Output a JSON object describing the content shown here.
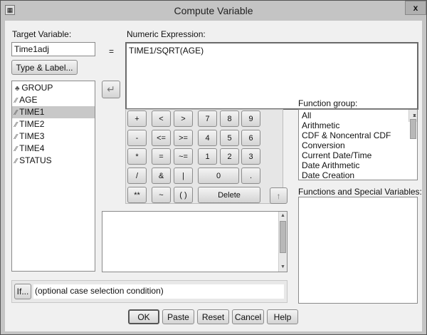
{
  "window": {
    "title": "Compute Variable",
    "close_label": "x"
  },
  "target": {
    "label": "Target Variable:",
    "value": "Time1adj",
    "type_label_button": "Type & Label..."
  },
  "equals": "=",
  "expression": {
    "label": "Numeric Expression:",
    "value": "TIME1/SQRT(AGE)"
  },
  "variables": [
    {
      "name": "GROUP",
      "icon": "nominal-icon",
      "selected": false
    },
    {
      "name": "AGE",
      "icon": "scale-ruler-icon",
      "selected": false
    },
    {
      "name": "TIME1",
      "icon": "scale-ruler-icon",
      "selected": true
    },
    {
      "name": "TIME2",
      "icon": "scale-ruler-icon",
      "selected": false
    },
    {
      "name": "TIME3",
      "icon": "scale-ruler-icon",
      "selected": false
    },
    {
      "name": "TIME4",
      "icon": "scale-ruler-icon",
      "selected": false
    },
    {
      "name": "STATUS",
      "icon": "scale-ruler-icon",
      "selected": false
    }
  ],
  "keypad": {
    "plus": "+",
    "lt": "<",
    "gt": ">",
    "k7": "7",
    "k8": "8",
    "k9": "9",
    "minus": "-",
    "le": "<=",
    "ge": ">=",
    "k4": "4",
    "k5": "5",
    "k6": "6",
    "mul": "*",
    "eq": "=",
    "ne": "~=",
    "k1": "1",
    "k2": "2",
    "k3": "3",
    "div": "/",
    "and": "&",
    "or": "|",
    "k0": "0",
    "dot": ".",
    "pow": "**",
    "not": "~",
    "paren": "( )",
    "delete": "Delete"
  },
  "function_group": {
    "label": "Function group:",
    "items": [
      "All",
      "Arithmetic",
      "CDF & Noncentral CDF",
      "Conversion",
      "Current Date/Time",
      "Date Arithmetic",
      "Date Creation"
    ]
  },
  "functions": {
    "label": "Functions and Special Variables:"
  },
  "if": {
    "button": "If...",
    "text": "(optional case selection condition)"
  },
  "buttons": {
    "ok": "OK",
    "paste": "Paste",
    "reset": "Reset",
    "cancel": "Cancel",
    "help": "Help"
  }
}
